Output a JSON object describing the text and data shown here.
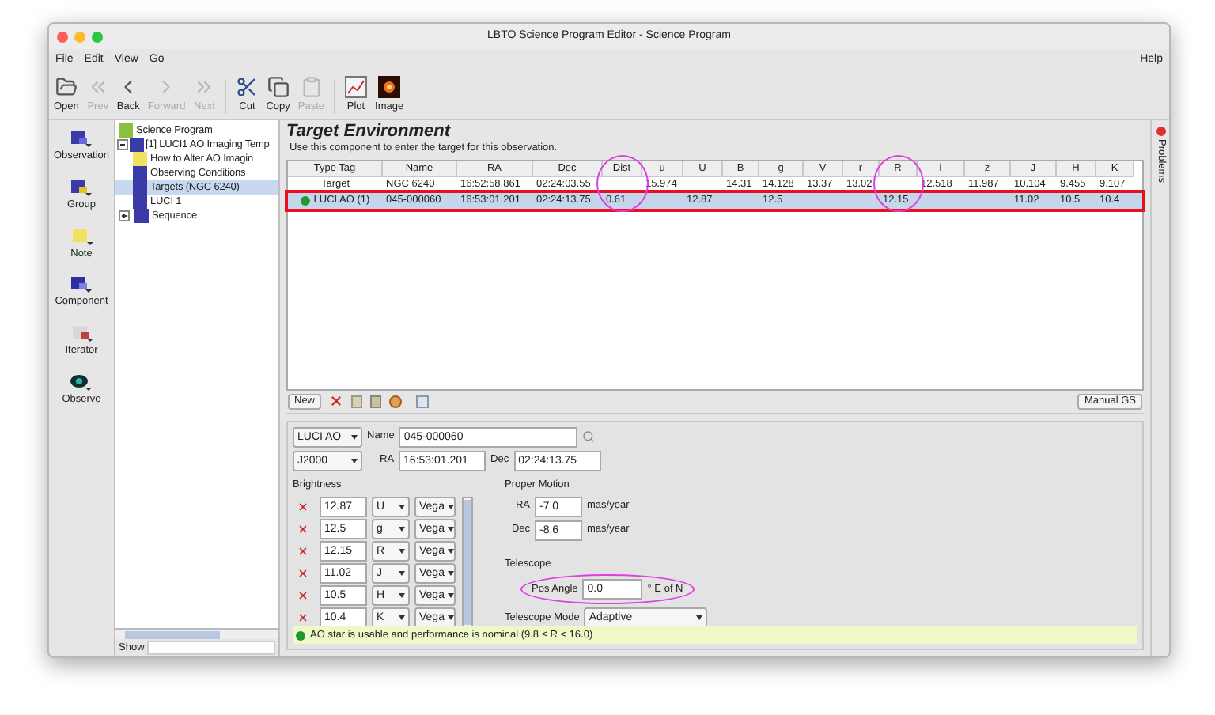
{
  "window": {
    "title": "LBTO Science Program Editor - Science Program"
  },
  "menu": {
    "items": [
      "File",
      "Edit",
      "View",
      "Go"
    ],
    "help": "Help"
  },
  "toolbar": [
    {
      "label": "Open",
      "disabled": false
    },
    {
      "label": "Prev",
      "disabled": true
    },
    {
      "label": "Back",
      "disabled": false
    },
    {
      "label": "Forward",
      "disabled": true
    },
    {
      "label": "Next",
      "disabled": true
    },
    {
      "label": "Cut",
      "disabled": false
    },
    {
      "label": "Copy",
      "disabled": false
    },
    {
      "label": "Paste",
      "disabled": true
    },
    {
      "label": "Plot",
      "disabled": false
    },
    {
      "label": "Image",
      "disabled": false
    }
  ],
  "palette": [
    "Observation",
    "Group",
    "Note",
    "Component",
    "Iterator",
    "Observe"
  ],
  "tree": {
    "label": "Science Program",
    "children": [
      {
        "label": "[1] LUCI1 AO Imaging Temp",
        "expanded": true,
        "selected": false,
        "children": [
          {
            "label": "How to Alter AO Imagin",
            "selected": false
          },
          {
            "label": "Observing Conditions",
            "selected": false
          },
          {
            "label": "Targets (NGC 6240)",
            "selected": true
          },
          {
            "label": "LUCI 1",
            "selected": false
          },
          {
            "label": "Sequence",
            "expanded": false,
            "selected": false
          }
        ]
      }
    ]
  },
  "tree_filter": {
    "label": "Show"
  },
  "side_tab": "Problems",
  "editor": {
    "title": "Target Environment",
    "subtitle": "Use this component to enter the target for this observation.",
    "table": {
      "columns": [
        {
          "label": "Type Tag",
          "circled": false
        },
        {
          "label": "Name",
          "circled": false
        },
        {
          "label": "RA",
          "circled": false
        },
        {
          "label": "Dec",
          "circled": false
        },
        {
          "label": "Dist",
          "circled": true
        },
        {
          "label": "u",
          "circled": false
        },
        {
          "label": "U",
          "circled": false
        },
        {
          "label": "B",
          "circled": false
        },
        {
          "label": "g",
          "circled": false
        },
        {
          "label": "V",
          "circled": false
        },
        {
          "label": "r",
          "circled": false
        },
        {
          "label": "R",
          "circled": true
        },
        {
          "label": "i",
          "circled": false
        },
        {
          "label": "z",
          "circled": false
        },
        {
          "label": "J",
          "circled": false
        },
        {
          "label": "H",
          "circled": false
        },
        {
          "label": "K",
          "circled": false
        }
      ],
      "rows": [
        {
          "selected": false,
          "highlighted": false,
          "cells": [
            "Target",
            "NGC 6240",
            "16:52:58.861",
            "02:24:03.55",
            null,
            "15.974",
            null,
            "14.31",
            "14.128",
            "13.37",
            "13.02",
            null,
            "12.518",
            "11.987",
            "10.104",
            "9.455",
            "9.107"
          ]
        },
        {
          "selected": true,
          "highlighted": true,
          "color": "#1f9a2a",
          "cells": [
            "LUCI AO (1)",
            "045-000060",
            "16:53:01.201",
            "02:24:13.75",
            "0.61",
            null,
            "12.87",
            null,
            "12.5",
            null,
            null,
            "12.15",
            null,
            null,
            "11.02",
            "10.5",
            "10.4"
          ]
        }
      ]
    },
    "table_buttons": {
      "new": "New",
      "manual": "Manual GS"
    },
    "target": {
      "type": "LUCI AO",
      "name_label": "Name",
      "name": "045-000060",
      "system": "J2000",
      "ra_label": "RA",
      "ra": "16:53:01.201",
      "dec_label": "Dec",
      "dec": "02:24:13.75"
    },
    "brightness": {
      "title": "Brightness",
      "rows": [
        {
          "value": "12.87",
          "band": "U",
          "system": "Vega"
        },
        {
          "value": "12.5",
          "band": "g",
          "system": "Vega"
        },
        {
          "value": "12.15",
          "band": "R",
          "system": "Vega"
        },
        {
          "value": "11.02",
          "band": "J",
          "system": "Vega"
        },
        {
          "value": "10.5",
          "band": "H",
          "system": "Vega"
        },
        {
          "value": "10.4",
          "band": "K",
          "system": "Vega"
        }
      ]
    },
    "proper_motion": {
      "title": "Proper Motion",
      "rows": [
        {
          "label": "RA",
          "value": "-7.0",
          "unit": "mas/year"
        },
        {
          "label": "Dec",
          "value": "-8.6",
          "unit": "mas/year"
        }
      ]
    },
    "telescope": {
      "title": "Telescope",
      "pos_angle": {
        "label": "Pos Angle",
        "value": "0.0",
        "unit": "° E of N",
        "circled": true
      },
      "mode": {
        "label": "Telescope Mode",
        "value": "Adaptive"
      }
    },
    "status": {
      "text": "AO star is usable and performance is nominal (9.8 ≤ R < 16.0)",
      "color": "#1f9a2a"
    }
  }
}
